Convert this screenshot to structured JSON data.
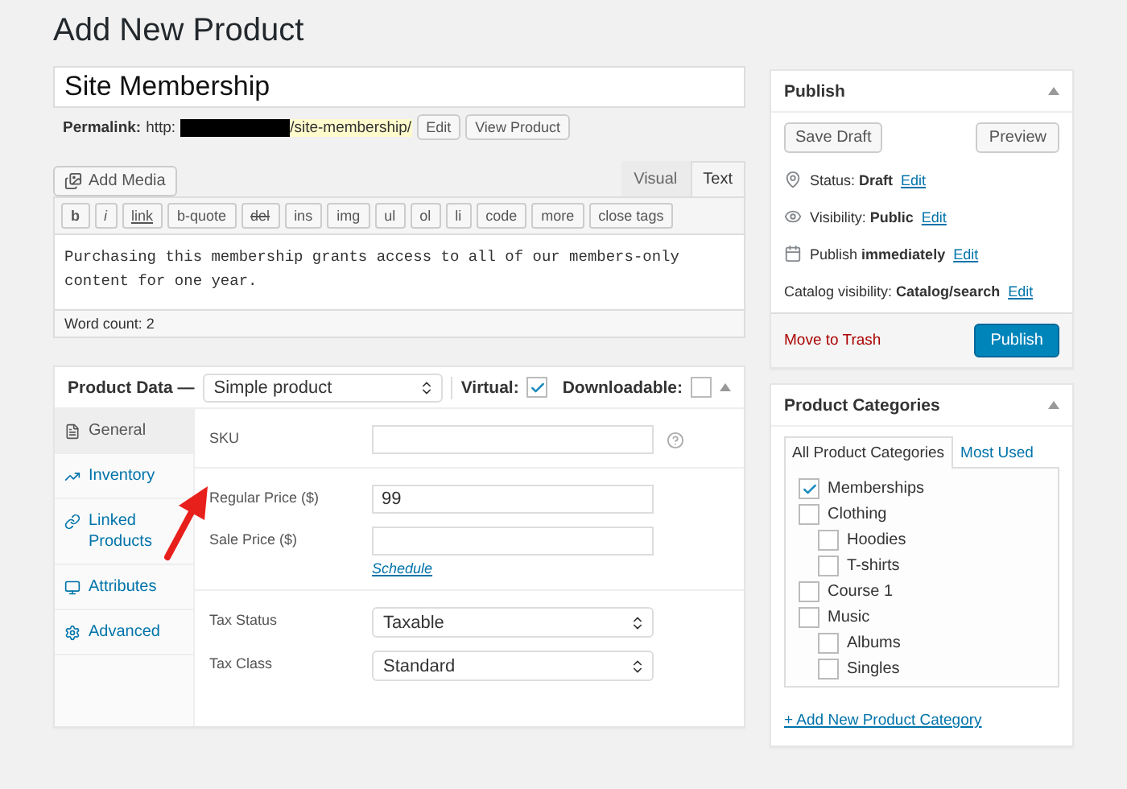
{
  "page_title": "Add New Product",
  "post_title": "Site Membership",
  "permalink": {
    "label": "Permalink:",
    "prefix": "http:",
    "slug": "/site-membership/",
    "buttons": [
      "Edit",
      "View Product"
    ]
  },
  "add_media": "Add Media",
  "editor_tabs": [
    {
      "label": "Visual",
      "selected": false
    },
    {
      "label": "Text",
      "selected": true
    }
  ],
  "quicktags": [
    {
      "label": "b",
      "kind": "bold"
    },
    {
      "label": "i",
      "kind": "italic"
    },
    {
      "label": "link",
      "kind": "link"
    },
    {
      "label": "b-quote",
      "kind": "plain"
    },
    {
      "label": "del",
      "kind": "strike"
    },
    {
      "label": "ins",
      "kind": "plain"
    },
    {
      "label": "img",
      "kind": "plain"
    },
    {
      "label": "ul",
      "kind": "plain"
    },
    {
      "label": "ol",
      "kind": "plain"
    },
    {
      "label": "li",
      "kind": "plain"
    },
    {
      "label": "code",
      "kind": "plain"
    },
    {
      "label": "more",
      "kind": "plain"
    },
    {
      "label": "close tags",
      "kind": "plain"
    }
  ],
  "editor_content": "Purchasing this membership grants access to all of our members-only content for one year.",
  "word_count": "Word count: 2",
  "product_data": {
    "title": "Product Data —",
    "type": "Simple product",
    "virtual": {
      "label": "Virtual:",
      "checked": true
    },
    "downloadable": {
      "label": "Downloadable:",
      "checked": false
    },
    "tabs": [
      {
        "label": "General",
        "kind": "general",
        "selected": true
      },
      {
        "label": "Inventory",
        "kind": "inventory",
        "selected": false
      },
      {
        "label": "Linked Products",
        "kind": "linked",
        "selected": false
      },
      {
        "label": "Attributes",
        "kind": "attributes",
        "selected": false
      },
      {
        "label": "Advanced",
        "kind": "advanced",
        "selected": false
      }
    ],
    "sections": [
      [
        {
          "label": "SKU",
          "kind": "text",
          "help": true
        }
      ],
      [
        {
          "label": "Regular Price ($)",
          "kind": "text",
          "value": "99"
        },
        {
          "label": "Sale Price ($)",
          "kind": "text",
          "link": "Schedule"
        }
      ],
      [
        {
          "label": "Tax Status",
          "kind": "select",
          "value": "Taxable"
        },
        {
          "label": "Tax Class",
          "kind": "select",
          "value": "Standard"
        }
      ]
    ]
  },
  "publish": {
    "title": "Publish",
    "save_draft": "Save Draft",
    "preview": "Preview",
    "rows": [
      {
        "kind": "status",
        "label": "Status:",
        "value": "Draft",
        "edit": "Edit"
      },
      {
        "kind": "visibility",
        "label": "Visibility:",
        "value": "Public",
        "edit": "Edit"
      },
      {
        "kind": "schedule",
        "label": "Publish",
        "value": "immediately",
        "edit": "Edit"
      },
      {
        "kind": "catalog",
        "label": "Catalog visibility:",
        "value": "Catalog/search",
        "edit": "Edit"
      }
    ],
    "trash": "Move to Trash",
    "publish": "Publish"
  },
  "categories": {
    "title": "Product Categories",
    "tabs": [
      {
        "label": "All Product Categories",
        "selected": true
      },
      {
        "label": "Most Used",
        "selected": false
      }
    ],
    "items": [
      {
        "label": "Memberships",
        "checked": true
      },
      {
        "label": "Clothing",
        "checked": false,
        "children": [
          {
            "label": "Hoodies",
            "checked": false
          },
          {
            "label": "T-shirts",
            "checked": false
          }
        ]
      },
      {
        "label": "Course 1",
        "checked": false
      },
      {
        "label": "Music",
        "checked": false,
        "children": [
          {
            "label": "Albums",
            "checked": false
          },
          {
            "label": "Singles",
            "checked": false
          }
        ]
      }
    ],
    "add_link": "+ Add New Product Category"
  }
}
